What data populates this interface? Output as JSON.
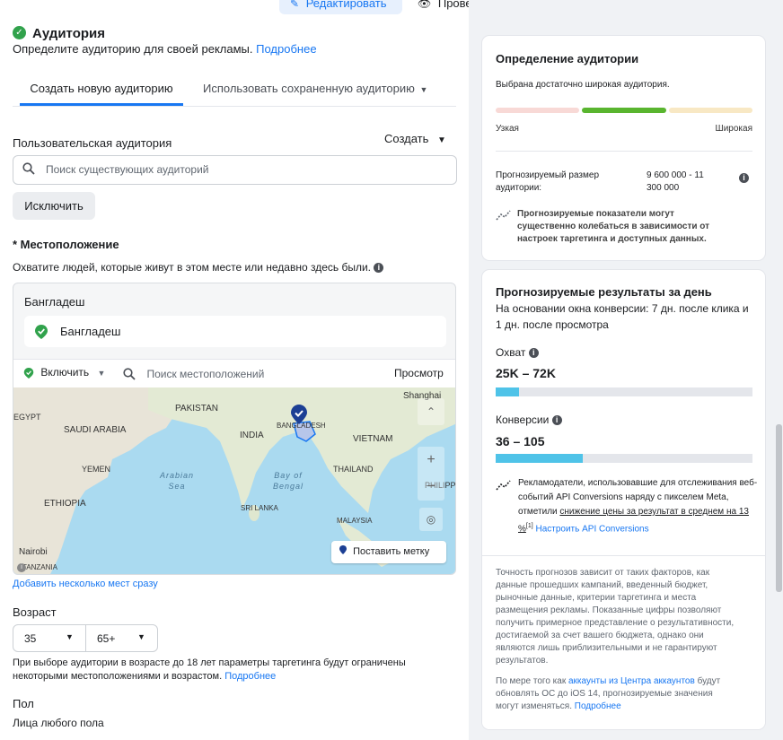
{
  "topbar": {
    "edit_label": "Редактировать",
    "review_label": "Проверка"
  },
  "audience": {
    "title": "Аудитория",
    "subtitle": "Определите аудиторию для своей рекламы.",
    "more_link": "Подробнее",
    "tabs": [
      {
        "label": "Создать новую аудиторию",
        "active": true
      },
      {
        "label": "Использовать сохраненную аудиторию",
        "active": false
      }
    ],
    "custom_label": "Пользовательская аудитория",
    "create_label": "Создать",
    "search_placeholder": "Поиск существующих аудиторий",
    "exclude_label": "Исключить"
  },
  "location": {
    "heading": "* Местоположение",
    "description": "Охватите людей, которые живут в этом месте или недавно здесь были.",
    "country_header": "Бангладеш",
    "selected_item": "Бангладеш",
    "include_label": "Включить",
    "search_placeholder": "Поиск местоположений",
    "view_label": "Просмотр",
    "add_multiple_link": "Добавить несколько мест сразу",
    "drop_pin_label": "Поставить метку",
    "map_labels": [
      {
        "text": "Shanghai",
        "kind": "country"
      },
      {
        "text": "PAKISTAN",
        "kind": "country"
      },
      {
        "text": "INDIA",
        "kind": "country"
      },
      {
        "text": "BANGLADESH",
        "kind": "country"
      },
      {
        "text": "SAUDI ARABIA",
        "kind": "country"
      },
      {
        "text": "VIETNAM",
        "kind": "country"
      },
      {
        "text": "THAILAND",
        "kind": "country"
      },
      {
        "text": "YEMEN",
        "kind": "country"
      },
      {
        "text": "ETHIOPIA",
        "kind": "country"
      },
      {
        "text": "SRI LANKA",
        "kind": "country"
      },
      {
        "text": "MALAYSIA",
        "kind": "country"
      },
      {
        "text": "EGYPT",
        "kind": "country"
      },
      {
        "text": "PHILIPP",
        "kind": "country"
      },
      {
        "text": "Arabian Sea",
        "kind": "sea"
      },
      {
        "text": "Bay of Bengal",
        "kind": "sea"
      },
      {
        "text": "Nairobi",
        "kind": "city"
      },
      {
        "text": "TANZANIA",
        "kind": "country"
      }
    ]
  },
  "age": {
    "label": "Возраст",
    "min": "35",
    "max": "65+",
    "note": "При выборе аудитории в возрасте до 18 лет параметры таргетинга будут ограничены некоторыми местоположениями и возрастом.",
    "more_link": "Подробнее"
  },
  "gender": {
    "label": "Пол",
    "value": "Лица любого пола"
  },
  "definition": {
    "title": "Определение аудитории",
    "status": "Выбрана достаточно широкая аудитория.",
    "gauge_level": "broad",
    "narrow_label": "Узкая",
    "broad_label": "Широкая",
    "size_label": "Прогнозируемый размер аудитории:",
    "size_value": "9 600 000 - 11 300 000",
    "estimate_note": "Прогнозируемые показатели могут существенно колебаться в зависимости от настроек таргетинга и доступных данных."
  },
  "daily": {
    "title": "Прогнозируемые результаты за день",
    "subtitle": "На основании окна конверсии: 7 дн. после клика и 1 дн. после просмотра",
    "reach_label": "Охват",
    "reach_value": "25K – 72K",
    "reach_fill": 0.09,
    "conv_label": "Конверсии",
    "conv_value": "36 – 105",
    "conv_fill": 0.34,
    "api_text_1": "Рекламодатели, использовавшие для отслеживания веб-событий API Conversions наряду с пикселем Meta, отметили",
    "api_text_link": "снижение цены за результат в среднем на 13 %",
    "api_footnote": "[1]",
    "api_setup_link": "Настроить API Conversions",
    "accuracy_note": "Точность прогнозов зависит от таких факторов, как данные прошедших кампаний, введенный бюджет, рыночные данные, критерии таргетинга и места размещения рекламы. Показанные цифры позволяют получить примерное представление о результативности, достигаемой за счет вашего бюджета, однако они являются лишь приблизительными и не гарантируют результатов.",
    "ios_text_1": "По мере того как",
    "ios_link": "аккаунты из Центра аккаунтов",
    "ios_text_2": "будут обновлять ОС до iOS 14, прогнозируемые значения могут изменяться.",
    "ios_more": "Подробнее"
  },
  "colors": {
    "accent": "#1877f2",
    "success": "#31a24c",
    "bar": "#4fc3e8",
    "gauge_broad": "#59b52f"
  }
}
